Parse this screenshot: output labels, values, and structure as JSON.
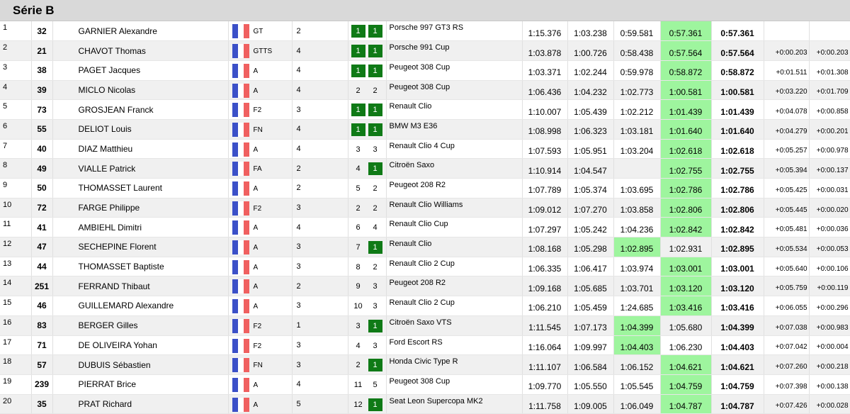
{
  "title": "Série B",
  "rows": [
    {
      "pos": "1",
      "num": "32",
      "name": "GARNIER Alexandre",
      "cls": "GT",
      "grp": "2",
      "r1": "1",
      "r2": "1",
      "f1": true,
      "f2": true,
      "car": "Porsche 997 GT3 RS",
      "t1": "1:15.376",
      "t2": "1:03.238",
      "t3": "0:59.581",
      "t4": "0:57.361",
      "bt": "0:57.361",
      "g1": "",
      "g2": "",
      "b3": false,
      "b4": true
    },
    {
      "pos": "2",
      "num": "21",
      "name": "CHAVOT Thomas",
      "cls": "GTTS",
      "grp": "4",
      "r1": "1",
      "r2": "1",
      "f1": true,
      "f2": true,
      "car": "Porsche 991 Cup",
      "t1": "1:03.878",
      "t2": "1:00.726",
      "t3": "0:58.438",
      "t4": "0:57.564",
      "bt": "0:57.564",
      "g1": "+0:00.203",
      "g2": "+0:00.203",
      "b3": false,
      "b4": true
    },
    {
      "pos": "3",
      "num": "38",
      "name": "PAGET Jacques",
      "cls": "A",
      "grp": "4",
      "r1": "1",
      "r2": "1",
      "f1": true,
      "f2": true,
      "car": "Peugeot 308 Cup",
      "t1": "1:03.371",
      "t2": "1:02.244",
      "t3": "0:59.978",
      "t4": "0:58.872",
      "bt": "0:58.872",
      "g1": "+0:01.511",
      "g2": "+0:01.308",
      "b3": false,
      "b4": true
    },
    {
      "pos": "4",
      "num": "39",
      "name": "MICLO Nicolas",
      "cls": "A",
      "grp": "4",
      "r1": "2",
      "r2": "2",
      "f1": false,
      "f2": false,
      "car": "Peugeot 308 Cup",
      "t1": "1:06.436",
      "t2": "1:04.232",
      "t3": "1:02.773",
      "t4": "1:00.581",
      "bt": "1:00.581",
      "g1": "+0:03.220",
      "g2": "+0:01.709",
      "b3": false,
      "b4": true
    },
    {
      "pos": "5",
      "num": "73",
      "name": "GROSJEAN Franck",
      "cls": "F2",
      "grp": "3",
      "r1": "1",
      "r2": "1",
      "f1": true,
      "f2": true,
      "car": "Renault Clio",
      "t1": "1:10.007",
      "t2": "1:05.439",
      "t3": "1:02.212",
      "t4": "1:01.439",
      "bt": "1:01.439",
      "g1": "+0:04.078",
      "g2": "+0:00.858",
      "b3": false,
      "b4": true
    },
    {
      "pos": "6",
      "num": "55",
      "name": "DELIOT Louis",
      "cls": "FN",
      "grp": "4",
      "r1": "1",
      "r2": "1",
      "f1": true,
      "f2": true,
      "car": "BMW M3 E36",
      "t1": "1:08.998",
      "t2": "1:06.323",
      "t3": "1:03.181",
      "t4": "1:01.640",
      "bt": "1:01.640",
      "g1": "+0:04.279",
      "g2": "+0:00.201",
      "b3": false,
      "b4": true
    },
    {
      "pos": "7",
      "num": "40",
      "name": "DIAZ Matthieu",
      "cls": "A",
      "grp": "4",
      "r1": "3",
      "r2": "3",
      "f1": false,
      "f2": false,
      "car": "Renault Clio 4 Cup",
      "t1": "1:07.593",
      "t2": "1:05.951",
      "t3": "1:03.204",
      "t4": "1:02.618",
      "bt": "1:02.618",
      "g1": "+0:05.257",
      "g2": "+0:00.978",
      "b3": false,
      "b4": true
    },
    {
      "pos": "8",
      "num": "49",
      "name": "VIALLE Patrick",
      "cls": "FA",
      "grp": "2",
      "r1": "4",
      "r2": "1",
      "f1": false,
      "f2": true,
      "car": "Citroën Saxo",
      "t1": "1:10.914",
      "t2": "1:04.547",
      "t3": "",
      "t4": "1:02.755",
      "bt": "1:02.755",
      "g1": "+0:05.394",
      "g2": "+0:00.137",
      "b3": false,
      "b4": true
    },
    {
      "pos": "9",
      "num": "50",
      "name": "THOMASSET Laurent",
      "cls": "A",
      "grp": "2",
      "r1": "5",
      "r2": "2",
      "f1": false,
      "f2": false,
      "car": "Peugeot 208 R2",
      "t1": "1:07.789",
      "t2": "1:05.374",
      "t3": "1:03.695",
      "t4": "1:02.786",
      "bt": "1:02.786",
      "g1": "+0:05.425",
      "g2": "+0:00.031",
      "b3": false,
      "b4": true
    },
    {
      "pos": "10",
      "num": "72",
      "name": "FARGE Philippe",
      "cls": "F2",
      "grp": "3",
      "r1": "2",
      "r2": "2",
      "f1": false,
      "f2": false,
      "car": "Renault Clio Williams",
      "t1": "1:09.012",
      "t2": "1:07.270",
      "t3": "1:03.858",
      "t4": "1:02.806",
      "bt": "1:02.806",
      "g1": "+0:05.445",
      "g2": "+0:00.020",
      "b3": false,
      "b4": true
    },
    {
      "pos": "11",
      "num": "41",
      "name": "AMBIEHL Dimitri",
      "cls": "A",
      "grp": "4",
      "r1": "6",
      "r2": "4",
      "f1": false,
      "f2": false,
      "car": "Renault Clio Cup",
      "t1": "1:07.297",
      "t2": "1:05.242",
      "t3": "1:04.236",
      "t4": "1:02.842",
      "bt": "1:02.842",
      "g1": "+0:05.481",
      "g2": "+0:00.036",
      "b3": false,
      "b4": true
    },
    {
      "pos": "12",
      "num": "47",
      "name": "SECHEPINE Florent",
      "cls": "A",
      "grp": "3",
      "r1": "7",
      "r2": "1",
      "f1": false,
      "f2": true,
      "car": "Renault Clio",
      "t1": "1:08.168",
      "t2": "1:05.298",
      "t3": "1:02.895",
      "t4": "1:02.931",
      "bt": "1:02.895",
      "g1": "+0:05.534",
      "g2": "+0:00.053",
      "b3": true,
      "b4": false
    },
    {
      "pos": "13",
      "num": "44",
      "name": "THOMASSET Baptiste",
      "cls": "A",
      "grp": "3",
      "r1": "8",
      "r2": "2",
      "f1": false,
      "f2": false,
      "car": "Renault Clio 2 Cup",
      "t1": "1:06.335",
      "t2": "1:06.417",
      "t3": "1:03.974",
      "t4": "1:03.001",
      "bt": "1:03.001",
      "g1": "+0:05.640",
      "g2": "+0:00.106",
      "b3": false,
      "b4": true
    },
    {
      "pos": "14",
      "num": "251",
      "name": "FERRAND Thibaut",
      "cls": "A",
      "grp": "2",
      "r1": "9",
      "r2": "3",
      "f1": false,
      "f2": false,
      "car": "Peugeot 208 R2",
      "t1": "1:09.168",
      "t2": "1:05.685",
      "t3": "1:03.701",
      "t4": "1:03.120",
      "bt": "1:03.120",
      "g1": "+0:05.759",
      "g2": "+0:00.119",
      "b3": false,
      "b4": true
    },
    {
      "pos": "15",
      "num": "46",
      "name": "GUILLEMARD Alexandre",
      "cls": "A",
      "grp": "3",
      "r1": "10",
      "r2": "3",
      "f1": false,
      "f2": false,
      "car": "Renault Clio 2 Cup",
      "t1": "1:06.210",
      "t2": "1:05.459",
      "t3": "1:24.685",
      "t4": "1:03.416",
      "bt": "1:03.416",
      "g1": "+0:06.055",
      "g2": "+0:00.296",
      "b3": false,
      "b4": true
    },
    {
      "pos": "16",
      "num": "83",
      "name": "BERGER Gilles",
      "cls": "F2",
      "grp": "1",
      "r1": "3",
      "r2": "1",
      "f1": false,
      "f2": true,
      "car": "Citroën Saxo VTS",
      "t1": "1:11.545",
      "t2": "1:07.173",
      "t3": "1:04.399",
      "t4": "1:05.680",
      "bt": "1:04.399",
      "g1": "+0:07.038",
      "g2": "+0:00.983",
      "b3": true,
      "b4": false
    },
    {
      "pos": "17",
      "num": "71",
      "name": "DE OLIVEIRA Yohan",
      "cls": "F2",
      "grp": "3",
      "r1": "4",
      "r2": "3",
      "f1": false,
      "f2": false,
      "car": "Ford Escort RS",
      "t1": "1:16.064",
      "t2": "1:09.997",
      "t3": "1:04.403",
      "t4": "1:06.230",
      "bt": "1:04.403",
      "g1": "+0:07.042",
      "g2": "+0:00.004",
      "b3": true,
      "b4": false
    },
    {
      "pos": "18",
      "num": "57",
      "name": "DUBUIS Sébastien",
      "cls": "FN",
      "grp": "3",
      "r1": "2",
      "r2": "1",
      "f1": false,
      "f2": true,
      "car": "Honda Civic Type R",
      "t1": "1:11.107",
      "t2": "1:06.584",
      "t3": "1:06.152",
      "t4": "1:04.621",
      "bt": "1:04.621",
      "g1": "+0:07.260",
      "g2": "+0:00.218",
      "b3": false,
      "b4": true
    },
    {
      "pos": "19",
      "num": "239",
      "name": "PIERRAT Brice",
      "cls": "A",
      "grp": "4",
      "r1": "11",
      "r2": "5",
      "f1": false,
      "f2": false,
      "car": "Peugeot 308 Cup",
      "t1": "1:09.770",
      "t2": "1:05.550",
      "t3": "1:05.545",
      "t4": "1:04.759",
      "bt": "1:04.759",
      "g1": "+0:07.398",
      "g2": "+0:00.138",
      "b3": false,
      "b4": true
    },
    {
      "pos": "20",
      "num": "35",
      "name": "PRAT Richard",
      "cls": "A",
      "grp": "5",
      "r1": "12",
      "r2": "1",
      "f1": false,
      "f2": true,
      "car": "Seat Leon Supercopa MK2",
      "t1": "1:11.758",
      "t2": "1:09.005",
      "t3": "1:06.049",
      "t4": "1:04.787",
      "bt": "1:04.787",
      "g1": "+0:07.426",
      "g2": "+0:00.028",
      "b3": false,
      "b4": true
    }
  ]
}
